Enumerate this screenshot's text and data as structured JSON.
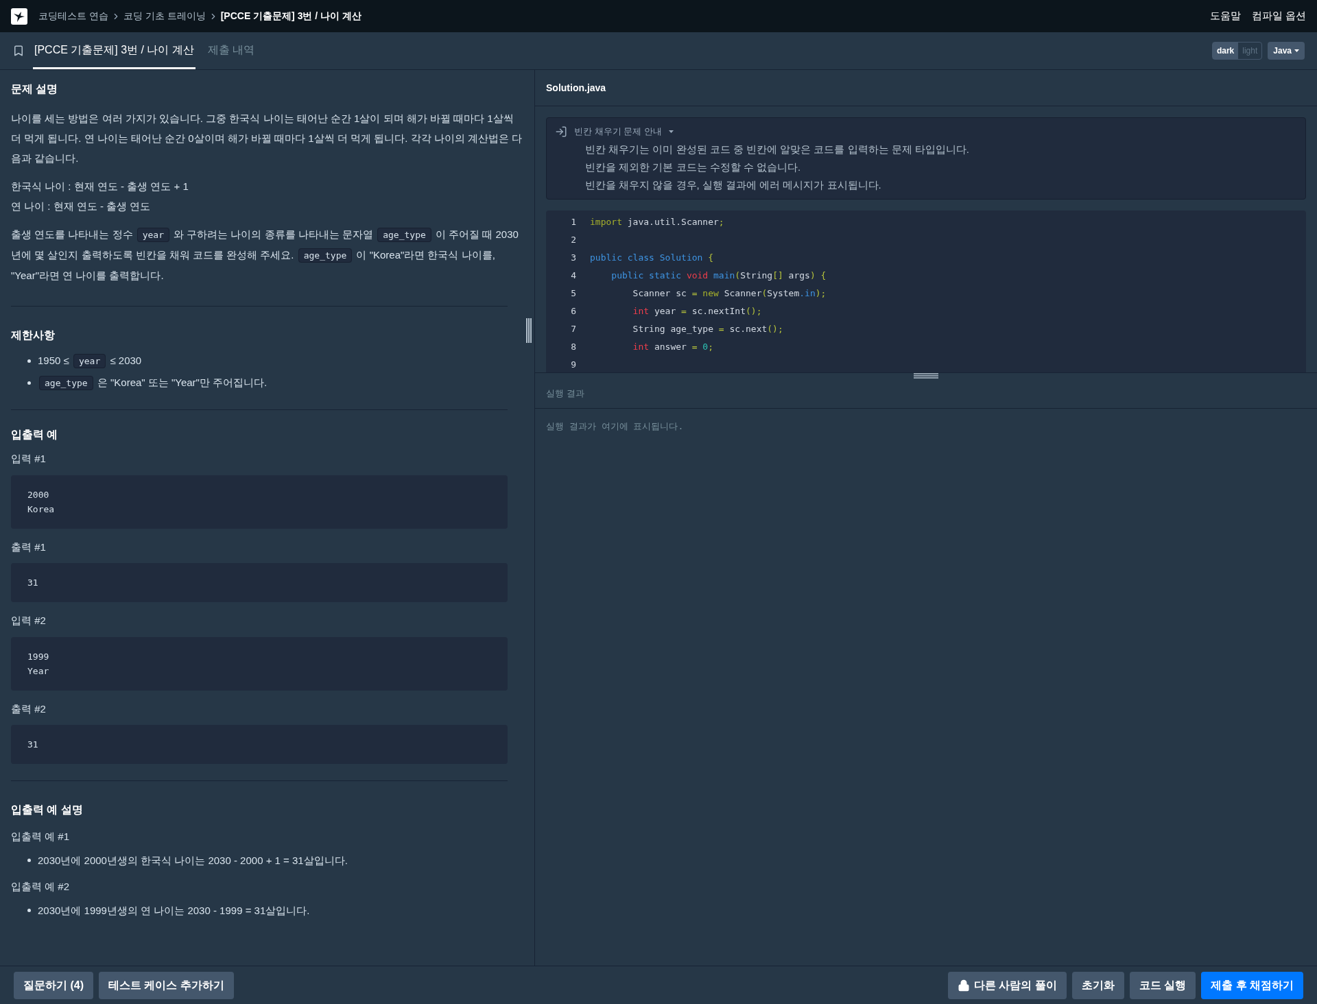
{
  "breadcrumb": [
    "코딩테스트 연습",
    "코딩 기초 트레이닝",
    "[PCCE 기출문제] 3번 / 나이 계산"
  ],
  "top_links": [
    "도움말",
    "컴파일 옵션"
  ],
  "tabs": [
    {
      "label": "[PCCE 기출문제] 3번 / 나이 계산",
      "selected": true
    },
    {
      "label": "제출 내역",
      "selected": false
    }
  ],
  "theme_toggle": [
    {
      "label": "dark",
      "selected": true
    },
    {
      "label": "light",
      "selected": false
    }
  ],
  "language": "Java",
  "problem": {
    "title": "문제 설명",
    "paragraphs": [
      [
        {
          "text": "나이를 세는 방법은 여러 가지가 있습니다. 그중 한국식 나이는 태어난 순간 1살이 되며 해가 바뀔 때마다 1살씩 더 먹게 됩니다. 연 나이는 태어난 순간 0살이며 해가 바뀔 때마다 1살씩 더 먹게 됩니다. 각각 나이의 계산법은 다음과 같습니다.",
          "code": false
        }
      ],
      [
        {
          "text": "한국식 나이 : 현재 연도 - 출생 연도 + 1",
          "code": false
        }
      ],
      [
        {
          "text": "연 나이 : 현재 연도 - 출생 연도",
          "code": false
        }
      ],
      [
        {
          "text": "출생 연도를 나타내는 정수 ",
          "code": false
        },
        {
          "text": "year",
          "code": true
        },
        {
          "text": " 와 구하려는 나이의 종류를 나타내는 문자열 ",
          "code": false
        },
        {
          "text": "age_type",
          "code": true
        },
        {
          "text": " 이 주어질 때 2030년에 몇 살인지 출력하도록 빈칸을 채워 코드를 완성해 주세요. ",
          "code": false
        },
        {
          "text": "age_type",
          "code": true
        },
        {
          "text": " 이 \"Korea\"라면 한국식 나이를, \"Year\"라면 연 나이를 출력합니다.",
          "code": false
        }
      ]
    ]
  },
  "constraints": {
    "title": "제한사항",
    "items": [
      [
        {
          "text": "1950 ≤ ",
          "code": false
        },
        {
          "text": "year",
          "code": true
        },
        {
          "text": " ≤ 2030",
          "code": false
        }
      ],
      [
        {
          "text": "age_type",
          "code": true
        },
        {
          "text": " 은 \"Korea\" 또는 \"Year\"만 주어집니다.",
          "code": false
        }
      ]
    ]
  },
  "examples": {
    "title": "입출력 예",
    "blocks": [
      {
        "label": "입력 #1",
        "lines": [
          "2000",
          "Korea"
        ]
      },
      {
        "label": "출력 #1",
        "lines": [
          "31"
        ]
      },
      {
        "label": "입력 #2",
        "lines": [
          "1999",
          "Year"
        ]
      },
      {
        "label": "출력 #2",
        "lines": [
          "31"
        ]
      }
    ]
  },
  "explanation": {
    "title": "입출력 예 설명",
    "groups": [
      {
        "label": "입출력 예 #1",
        "items": [
          "2030년에 2000년생의 한국식 나이는 2030 - 2000 + 1 = 31살입니다."
        ]
      },
      {
        "label": "입출력 예 #2",
        "items": [
          "2030년에 1999년생의 연 나이는 2030 - 1999 = 31살입니다."
        ]
      }
    ]
  },
  "editor": {
    "file": "Solution.java",
    "guide": {
      "title": "빈칸 채우기 문제 안내",
      "expanded": true,
      "lines": [
        "빈칸 채우기는 이미 완성된 코드 중 빈칸에 알맞은 코드를 입력하는 문제 타입입니다.",
        "빈칸을 제외한 기본 코드는 수정할 수 없습니다.",
        "빈칸을 채우지 않을 경우, 실행 결과에 에러 메시지가 표시됩니다."
      ]
    },
    "lines": [
      {
        "number": "1",
        "tokens": [
          {
            "text": "import",
            "kind": "olive"
          },
          {
            "text": " java.util.Scanner",
            "kind": "plain"
          },
          {
            "text": ";",
            "kind": "punct"
          }
        ]
      },
      {
        "number": "2"
      },
      {
        "number": "3",
        "tokens": [
          {
            "text": "public class Solution",
            "kind": "blue"
          },
          {
            "text": " {",
            "kind": "punct"
          }
        ]
      },
      {
        "number": "4",
        "tokens": [
          {
            "text": "    public static",
            "kind": "blue"
          },
          {
            "text": " void",
            "kind": "red"
          },
          {
            "text": " main",
            "kind": "blue"
          },
          {
            "text": "(",
            "kind": "punct"
          },
          {
            "text": "String",
            "kind": "plain"
          },
          {
            "text": "[]",
            "kind": "punct"
          },
          {
            "text": " args",
            "kind": "plain"
          },
          {
            "text": ")",
            "kind": "punct"
          },
          {
            "text": " {",
            "kind": "punct"
          }
        ]
      },
      {
        "number": "5",
        "tokens": [
          {
            "text": "        Scanner sc ",
            "kind": "plain"
          },
          {
            "text": "=",
            "kind": "punct"
          },
          {
            "text": " new",
            "kind": "olive"
          },
          {
            "text": " Scanner",
            "kind": "plain"
          },
          {
            "text": "(",
            "kind": "punct"
          },
          {
            "text": "System",
            "kind": "plain"
          },
          {
            "text": ".in",
            "kind": "blue"
          },
          {
            "text": ");",
            "kind": "punct"
          }
        ]
      },
      {
        "number": "6",
        "tokens": [
          {
            "text": "        int",
            "kind": "red"
          },
          {
            "text": " year ",
            "kind": "plain"
          },
          {
            "text": "=",
            "kind": "punct"
          },
          {
            "text": " sc.nextInt",
            "kind": "plain"
          },
          {
            "text": "();",
            "kind": "punct"
          }
        ]
      },
      {
        "number": "7",
        "tokens": [
          {
            "text": "        String age_type ",
            "kind": "plain"
          },
          {
            "text": "=",
            "kind": "punct"
          },
          {
            "text": " sc.next",
            "kind": "plain"
          },
          {
            "text": "();",
            "kind": "punct"
          }
        ]
      },
      {
        "number": "8",
        "tokens": [
          {
            "text": "        int",
            "kind": "red"
          },
          {
            "text": " answer ",
            "kind": "plain"
          },
          {
            "text": "=",
            "kind": "punct"
          },
          {
            "text": " 0",
            "kind": "number"
          },
          {
            "text": ";",
            "kind": "punct"
          }
        ]
      },
      {
        "number": "9"
      }
    ]
  },
  "result": {
    "title": "실행 결과",
    "placeholder": "실행 결과가 여기에 표시됩니다."
  },
  "footer_left": [
    "질문하기 (4)",
    "테스트 케이스 추가하기"
  ],
  "footer_right": [
    {
      "label": "다른 사람의 풀이",
      "kind": "locked"
    },
    {
      "label": "초기화",
      "kind": "plain"
    },
    {
      "label": "코드 실행",
      "kind": "plain"
    },
    {
      "label": "제출 후 채점하기",
      "kind": "primary"
    }
  ]
}
